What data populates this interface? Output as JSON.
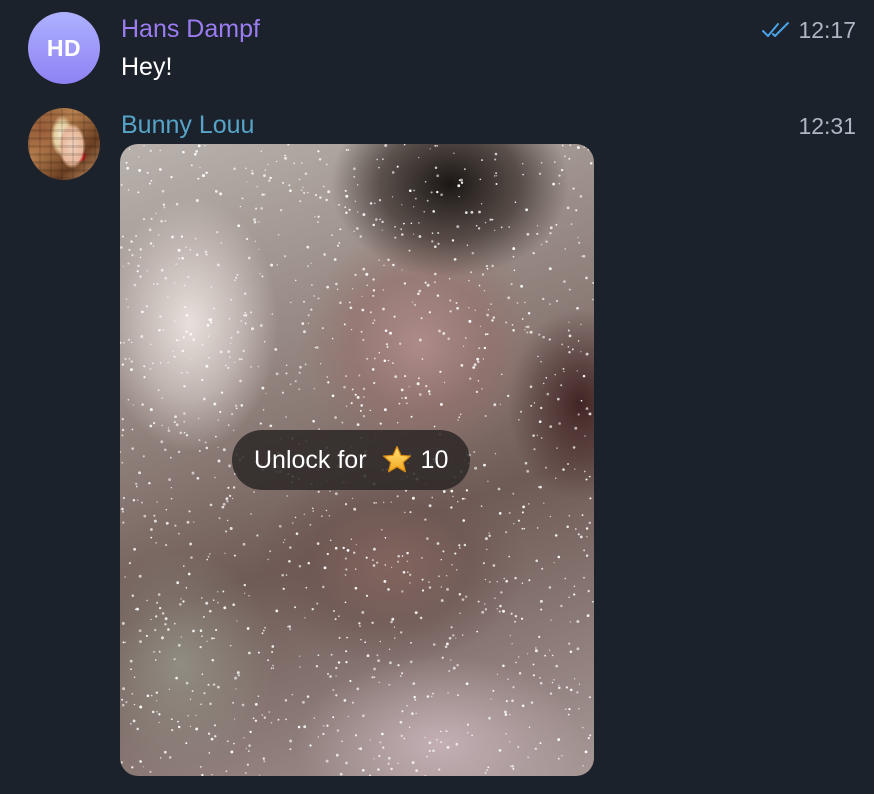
{
  "colors": {
    "background": "#1c222b",
    "sender_hans": "#9b7cf2",
    "sender_bunny": "#56a5c9",
    "check_mark": "#4aa3e8",
    "time_text": "#aeb6c2"
  },
  "messages": [
    {
      "avatar_initials": "HD",
      "sender": "Hans Dampf",
      "text": "Hey!",
      "time": "12:17",
      "status_icon": "double-check-icon"
    },
    {
      "avatar_icon": "profile-photo",
      "sender": "Bunny Louu",
      "time": "12:31",
      "media": {
        "blurred": true,
        "unlock_label": "Unlock for",
        "currency_icon": "star-icon",
        "price": "10"
      }
    }
  ]
}
